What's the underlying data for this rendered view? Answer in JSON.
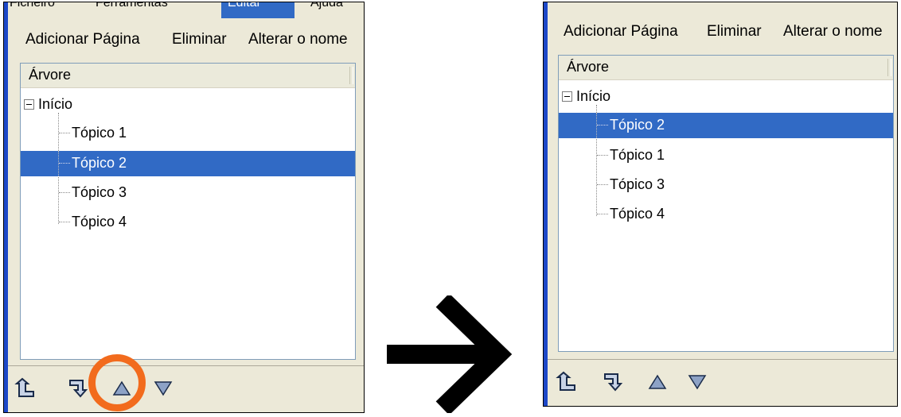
{
  "before": {
    "menu": {
      "items": [
        "Ficheiro",
        "Ferramentas",
        "Editar",
        "Ajuda"
      ]
    },
    "actions": [
      "Adicionar Página",
      "Eliminar",
      "Alterar o nome"
    ],
    "tree_header": "Árvore",
    "root": "Início",
    "topics": [
      "Tópico 1",
      "Tópico 2",
      "Tópico 3",
      "Tópico 4"
    ],
    "selected": "Tópico 2"
  },
  "after": {
    "actions": [
      "Adicionar Página",
      "Eliminar",
      "Alterar o nome"
    ],
    "tree_header": "Árvore",
    "root": "Início",
    "topics": [
      "Tópico 2",
      "Tópico 1",
      "Tópico 3",
      "Tópico 4"
    ],
    "selected": "Tópico 2"
  },
  "toolbar_icons": [
    "move-out-icon",
    "move-in-icon",
    "move-up-icon",
    "move-down-icon"
  ],
  "highlight_color": "#f26b1d",
  "selection_color": "#316ac5"
}
